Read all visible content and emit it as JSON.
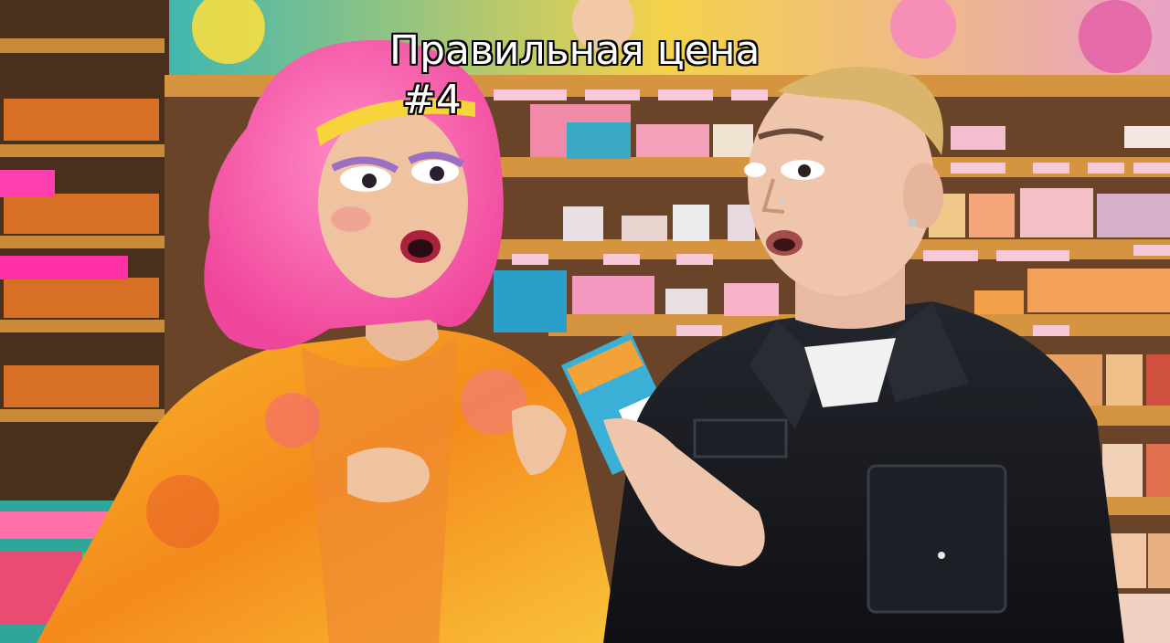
{
  "caption": {
    "title": "Правильная цена",
    "number": "#4"
  },
  "scene": {
    "colors": {
      "shelf_wood": "#c98a3a",
      "wall_mural": "#3fb7b0",
      "wig_pink": "#ff5fae",
      "robe_orange": "#f7a21a",
      "jacket_black": "#15161b",
      "hair_blonde": "#d8b56a"
    }
  }
}
